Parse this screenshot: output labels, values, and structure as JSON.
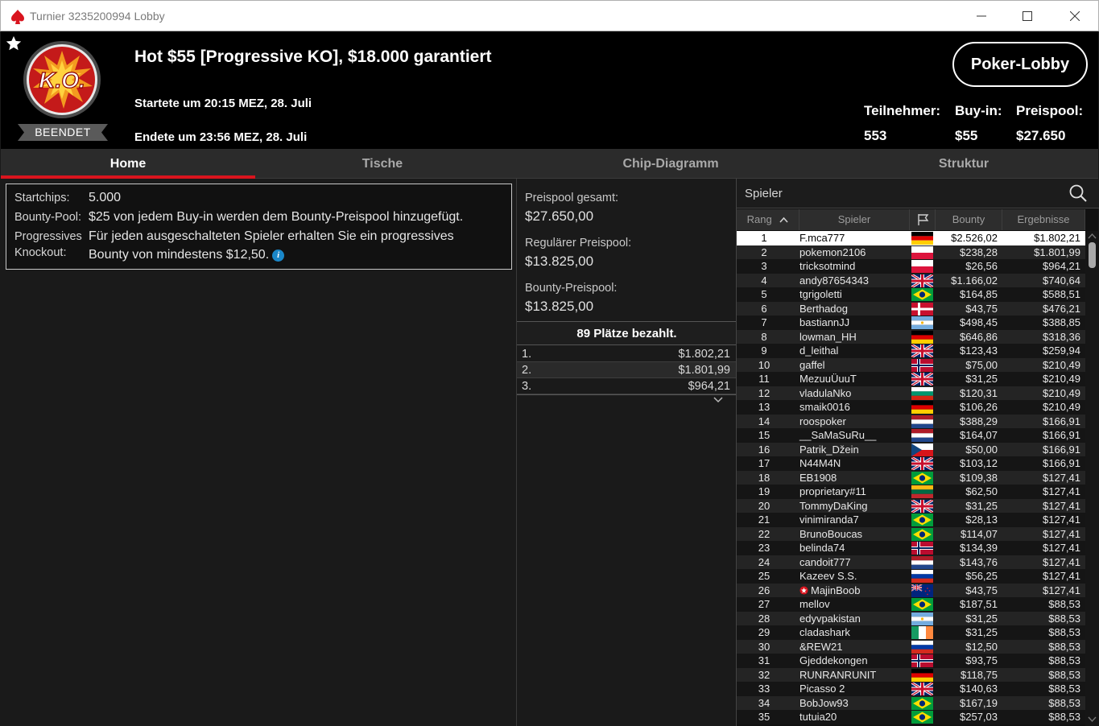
{
  "window": {
    "title": "Turnier 3235200994 Lobby"
  },
  "header": {
    "status": "BEENDET",
    "logo_text": "K.O.",
    "tournament_name": "Hot $55 [Progressive KO], $18.000 garantiert",
    "started": "Startete um 20:15 MEZ, 28. Juli",
    "ended": "Endete um 23:56 MEZ, 28. Juli",
    "lobby_button": "Poker-Lobby",
    "stats": [
      {
        "label": "Teilnehmer:",
        "value": "553"
      },
      {
        "label": "Buy-in:",
        "value": "$55"
      },
      {
        "label": "Preispool:",
        "value": "$27.650"
      }
    ]
  },
  "tabs": [
    {
      "label": "Home",
      "active": true
    },
    {
      "label": "Tische",
      "active": false
    },
    {
      "label": "Chip-Diagramm",
      "active": false
    },
    {
      "label": "Struktur",
      "active": false
    }
  ],
  "info": {
    "startchips_label": "Startchips:",
    "startchips_value": "5.000",
    "bounty_pool_label": "Bounty-Pool:",
    "bounty_pool_value": "$25 von jedem Buy-in werden dem Bounty-Preispool hinzugefügt.",
    "progressive_label_1": "Progressives",
    "progressive_label_2": "Knockout:",
    "progressive_value_1": "Für jeden ausgeschalteten Spieler erhalten Sie ein progressives",
    "progressive_value_2": "Bounty von mindestens $12,50."
  },
  "prizepool": {
    "total_label": "Preispool gesamt:",
    "total_value": "$27.650,00",
    "regular_label": "Regulärer Preispool:",
    "regular_value": "$13.825,00",
    "bounty_label": "Bounty-Preispool:",
    "bounty_value": "$13.825,00",
    "places_paid": "89 Plätze bezahlt.",
    "payouts": [
      {
        "pos": "1.",
        "amount": "$1.802,21"
      },
      {
        "pos": "2.",
        "amount": "$1.801,99"
      },
      {
        "pos": "3.",
        "amount": "$964,21"
      }
    ]
  },
  "players": {
    "title": "Spieler",
    "columns": {
      "rank": "Rang",
      "player": "Spieler",
      "bounty": "Bounty",
      "result": "Ergebnisse"
    },
    "rows": [
      {
        "rank": "1",
        "name": "F.mca777",
        "flag": "de",
        "bounty": "$2.526,02",
        "result": "$1.802,21"
      },
      {
        "rank": "2",
        "name": "pokemon2106",
        "flag": "pl",
        "bounty": "$238,28",
        "result": "$1.801,99"
      },
      {
        "rank": "3",
        "name": "tricksotmind",
        "flag": "pl",
        "bounty": "$26,56",
        "result": "$964,21"
      },
      {
        "rank": "4",
        "name": "andy87654343",
        "flag": "gb",
        "bounty": "$1.166,02",
        "result": "$740,64"
      },
      {
        "rank": "5",
        "name": "tgrigoletti",
        "flag": "br",
        "bounty": "$164,85",
        "result": "$588,51"
      },
      {
        "rank": "6",
        "name": "Berthadog",
        "flag": "dk",
        "bounty": "$43,75",
        "result": "$476,21"
      },
      {
        "rank": "7",
        "name": "bastiannJJ",
        "flag": "ar",
        "bounty": "$498,45",
        "result": "$388,85"
      },
      {
        "rank": "8",
        "name": "lowman_HH",
        "flag": "de",
        "bounty": "$646,86",
        "result": "$318,36"
      },
      {
        "rank": "9",
        "name": "d_leithal",
        "flag": "gb",
        "bounty": "$123,43",
        "result": "$259,94"
      },
      {
        "rank": "10",
        "name": "gaffel",
        "flag": "no",
        "bounty": "$75,00",
        "result": "$210,49"
      },
      {
        "rank": "11",
        "name": "MezuuÜuuT",
        "flag": "gb",
        "bounty": "$31,25",
        "result": "$210,49"
      },
      {
        "rank": "12",
        "name": "vladulaNko",
        "flag": "bg",
        "bounty": "$120,31",
        "result": "$210,49"
      },
      {
        "rank": "13",
        "name": "smaik0016",
        "flag": "de",
        "bounty": "$106,26",
        "result": "$210,49"
      },
      {
        "rank": "14",
        "name": "roospoker",
        "flag": "nl",
        "bounty": "$388,29",
        "result": "$166,91"
      },
      {
        "rank": "15",
        "name": "__SaMaSuRu__",
        "flag": "nl",
        "bounty": "$164,07",
        "result": "$166,91"
      },
      {
        "rank": "16",
        "name": "Patrik_Džein",
        "flag": "cz",
        "bounty": "$50,00",
        "result": "$166,91"
      },
      {
        "rank": "17",
        "name": "N44M4N",
        "flag": "gb",
        "bounty": "$103,12",
        "result": "$166,91"
      },
      {
        "rank": "18",
        "name": "EB1908",
        "flag": "br",
        "bounty": "$109,38",
        "result": "$127,41"
      },
      {
        "rank": "19",
        "name": "proprietary#11",
        "flag": "lt",
        "bounty": "$62,50",
        "result": "$127,41"
      },
      {
        "rank": "20",
        "name": "TommyDaKing",
        "flag": "gb",
        "bounty": "$31,25",
        "result": "$127,41"
      },
      {
        "rank": "21",
        "name": "vinimiranda7",
        "flag": "br",
        "bounty": "$28,13",
        "result": "$127,41"
      },
      {
        "rank": "22",
        "name": "BrunoBoucas",
        "flag": "br",
        "bounty": "$114,07",
        "result": "$127,41"
      },
      {
        "rank": "23",
        "name": "belinda74",
        "flag": "no",
        "bounty": "$134,39",
        "result": "$127,41"
      },
      {
        "rank": "24",
        "name": "candoit777",
        "flag": "nl",
        "bounty": "$143,76",
        "result": "$127,41"
      },
      {
        "rank": "25",
        "name": "Kazeev S.S.",
        "flag": "ru",
        "bounty": "$56,25",
        "result": "$127,41"
      },
      {
        "rank": "26",
        "name": "MajinBoob",
        "flag": "nz",
        "badge": true,
        "bounty": "$43,75",
        "result": "$127,41"
      },
      {
        "rank": "27",
        "name": "mellov",
        "flag": "br",
        "bounty": "$187,51",
        "result": "$88,53"
      },
      {
        "rank": "28",
        "name": "edyvpakistan",
        "flag": "ar",
        "bounty": "$31,25",
        "result": "$88,53"
      },
      {
        "rank": "29",
        "name": "cladashark",
        "flag": "ie",
        "bounty": "$31,25",
        "result": "$88,53"
      },
      {
        "rank": "30",
        "name": "&REW21",
        "flag": "ru",
        "bounty": "$12,50",
        "result": "$88,53"
      },
      {
        "rank": "31",
        "name": "Gjeddekongen",
        "flag": "no",
        "bounty": "$93,75",
        "result": "$88,53"
      },
      {
        "rank": "32",
        "name": "RUNRANRUNIT",
        "flag": "de",
        "bounty": "$118,75",
        "result": "$88,53"
      },
      {
        "rank": "33",
        "name": "Picasso 2",
        "flag": "gb",
        "bounty": "$140,63",
        "result": "$88,53"
      },
      {
        "rank": "34",
        "name": "BobJow93",
        "flag": "br",
        "bounty": "$167,19",
        "result": "$88,53"
      },
      {
        "rank": "35",
        "name": "tutuia20",
        "flag": "br",
        "bounty": "$257,03",
        "result": "$88,53"
      }
    ]
  },
  "colors": {
    "accent": "#d9141e",
    "info": "#1a87c9"
  },
  "icons": [
    "app-spade-icon",
    "favorite-star-icon",
    "ko-logo",
    "search-icon",
    "flag-icon",
    "sort-asc-icon",
    "chevron-down-icon",
    "info-icon"
  ]
}
